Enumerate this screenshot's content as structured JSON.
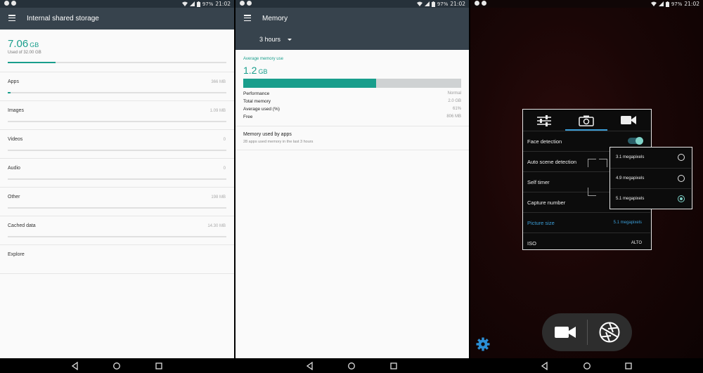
{
  "status_bar": {
    "battery": "97%",
    "time": "21:02"
  },
  "storage": {
    "title": "Internal shared storage",
    "used_value": "7.06",
    "used_unit": "GB",
    "used_of": "Used of 32.00 GB",
    "used_fraction": 0.22,
    "categories": [
      {
        "label": "Apps",
        "size": "366 MB",
        "fraction": 0.012
      },
      {
        "label": "Images",
        "size": "1.09 MB",
        "fraction": 0
      },
      {
        "label": "Videos",
        "size": "0",
        "fraction": 0
      },
      {
        "label": "Audio",
        "size": "0",
        "fraction": 0
      },
      {
        "label": "Other",
        "size": "198 MB",
        "fraction": 0
      },
      {
        "label": "Cached data",
        "size": "14.30 MB",
        "fraction": 0
      },
      {
        "label": "Explore",
        "size": "",
        "fraction": null
      }
    ]
  },
  "memory": {
    "title": "Memory",
    "period": "3 hours",
    "avg_label": "Average memory use",
    "avg_value": "1.2",
    "avg_unit": "GB",
    "avg_fraction": 0.61,
    "stats": [
      {
        "key": "Performance",
        "value": "Normal"
      },
      {
        "key": "Total memory",
        "value": "2.0 GB"
      },
      {
        "key": "Average used (%)",
        "value": "61%"
      },
      {
        "key": "Free",
        "value": "806 MB"
      }
    ],
    "apps_title": "Memory used by apps",
    "apps_subtitle": "28 apps used memory in the last 3 hours"
  },
  "camera": {
    "settings": [
      {
        "label": "Face detection",
        "value": "",
        "toggle": true
      },
      {
        "label": "Auto scene detection",
        "value": ""
      },
      {
        "label": "Self timer",
        "value": ""
      },
      {
        "label": "Capture number",
        "value": ""
      },
      {
        "label": "Picture size",
        "value": "5.1 megapixels",
        "highlight": true
      },
      {
        "label": "ISO",
        "value": "ALTO"
      }
    ],
    "size_options": [
      {
        "label": "3.1 megapixels",
        "selected": false
      },
      {
        "label": "4.9 megapixels",
        "selected": false
      },
      {
        "label": "5.1 megapixels",
        "selected": true
      }
    ]
  },
  "colors": {
    "accent": "#199e8c",
    "appbar": "#37434d",
    "camera_highlight": "#3b9dd6"
  }
}
